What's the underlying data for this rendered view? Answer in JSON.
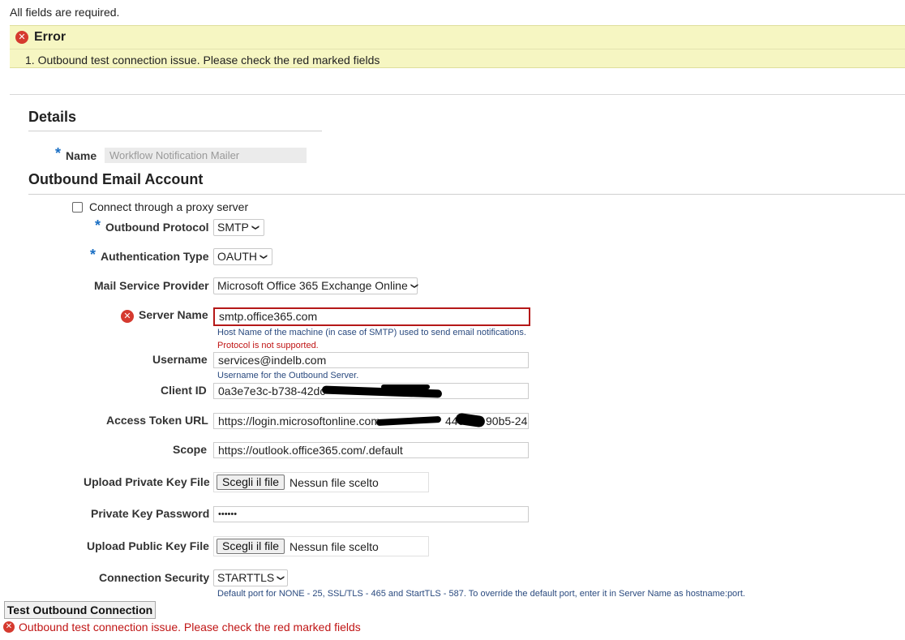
{
  "page": {
    "required_note": "All fields are required."
  },
  "error_box": {
    "title": "Error",
    "items": [
      "1. Outbound test connection issue. Please check the red marked fields"
    ]
  },
  "details": {
    "title": "Details",
    "name_label": "Name",
    "name_value": "Workflow Notification Mailer"
  },
  "outbound": {
    "title": "Outbound Email Account",
    "proxy_label": "Connect through a proxy server",
    "proxy_checked": false,
    "protocol_label": "Outbound Protocol",
    "protocol_value": "SMTP",
    "auth_label": "Authentication Type",
    "auth_value": "OAUTH",
    "provider_label": "Mail Service Provider",
    "provider_value": "Microsoft Office 365 Exchange Online",
    "server_label": "Server Name",
    "server_value": "smtp.office365.com",
    "server_hint": "Host Name of the machine (in case of SMTP) used to send email notifications.",
    "server_error": "Protocol is not supported.",
    "username_label": "Username",
    "username_value": "services@indelb.com",
    "username_hint": "Username for the Outbound Server.",
    "client_id_label": "Client ID",
    "client_id_value": "0a3e7e3c-b738-42dc",
    "token_url_label": "Access Token URL",
    "token_url_value": "https://login.microsoftonline.com",
    "token_url_tail_a": "440e",
    "token_url_tail_b": "90b5-24",
    "scope_label": "Scope",
    "scope_value": "https://outlook.office365.com/.default",
    "private_key_file_label": "Upload Private Key File",
    "private_key_password_label": "Private Key Password",
    "private_key_password_value": "••••••",
    "public_key_file_label": "Upload Public Key File",
    "file_button_label": "Scegli il file",
    "file_none_label": "Nessun file scelto",
    "security_label": "Connection Security",
    "security_value": "STARTTLS",
    "security_hint": "Default port for NONE - 25, SSL/TLS - 465 and StartTLS - 587. To override the default port, enter it in Server Name as hostname:port."
  },
  "actions": {
    "test_button_label": "Test Outbound Connection",
    "bottom_error": "Outbound test connection issue. Please check the red marked fields"
  },
  "icons": {
    "error_icon_glyph": "✕",
    "chevron_glyph": "❯",
    "required_star": "*"
  },
  "colors": {
    "error_bg": "#f6f6c2",
    "error_red": "#c01515",
    "required_blue": "#1a6fc4",
    "hint_blue": "#2a4a7f"
  }
}
